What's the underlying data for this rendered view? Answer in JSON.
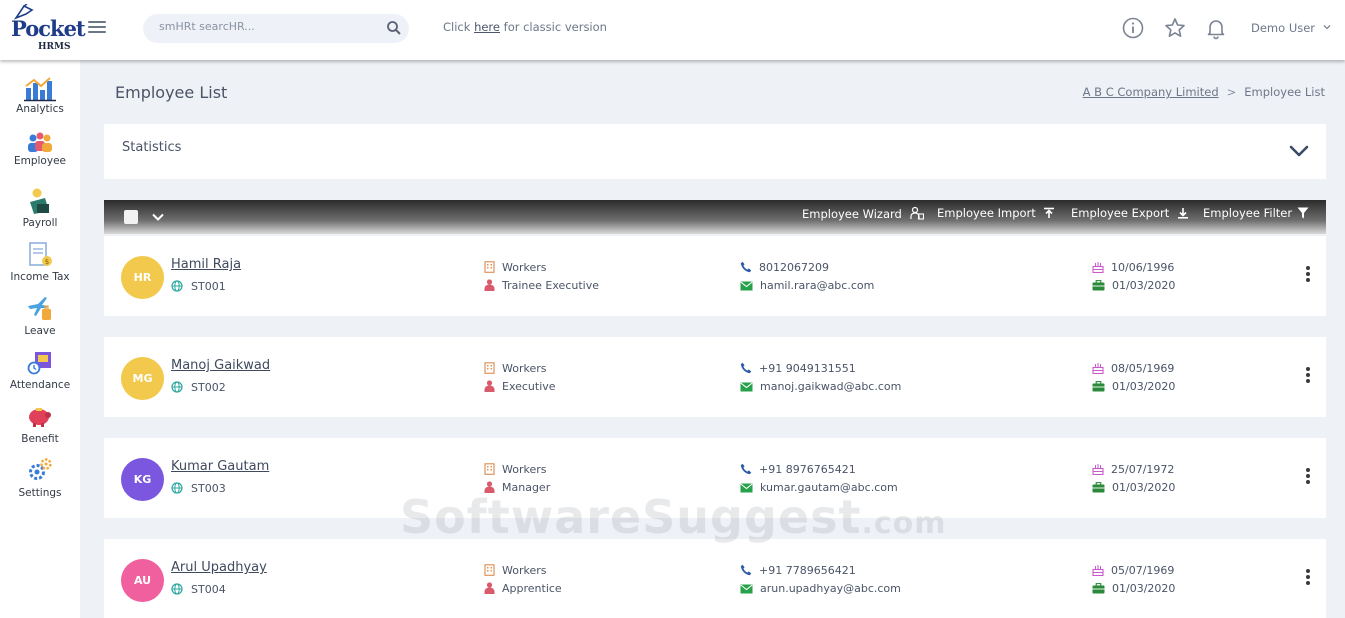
{
  "brand": {
    "logo_text": "Pocket",
    "logo_sub": "HRMS"
  },
  "header": {
    "search_placeholder": "smHRt searcHR...",
    "classic_prefix": "Click ",
    "classic_link": "here",
    "classic_suffix": " for classic version",
    "user_name": "Demo User"
  },
  "sidebar": {
    "items": [
      {
        "label": "Analytics",
        "icon": "analytics-icon"
      },
      {
        "label": "Employee",
        "icon": "employee-icon"
      },
      {
        "label": "Payroll",
        "icon": "payroll-icon"
      },
      {
        "label": "Income Tax",
        "icon": "income-tax-icon"
      },
      {
        "label": "Leave",
        "icon": "leave-icon"
      },
      {
        "label": "Attendance",
        "icon": "attendance-icon"
      },
      {
        "label": "Benefit",
        "icon": "benefit-icon"
      },
      {
        "label": "Settings",
        "icon": "settings-icon"
      }
    ]
  },
  "page": {
    "title": "Employee List",
    "breadcrumb_company": "A B C Company Limited",
    "breadcrumb_current": "Employee List",
    "statistics_label": "Statistics"
  },
  "toolbar": {
    "wizard": "Employee Wizard",
    "import": "Employee Import",
    "export": "Employee Export",
    "filter": "Employee Filter"
  },
  "employees": [
    {
      "initials": "HR",
      "avatar_color": "#f2c94c",
      "name": "Hamil Raja",
      "code": "ST001",
      "category": "Workers",
      "designation": "Trainee Executive",
      "phone": "8012067209",
      "email": "hamil.rara@abc.com",
      "dob": "10/06/1996",
      "doj": "01/03/2020"
    },
    {
      "initials": "MG",
      "avatar_color": "#f2c94c",
      "name": "Manoj Gaikwad",
      "code": "ST002",
      "category": "Workers",
      "designation": "Executive",
      "phone": "+91 9049131551",
      "email": "manoj.gaikwad@abc.com",
      "dob": "08/05/1969",
      "doj": "01/03/2020"
    },
    {
      "initials": "KG",
      "avatar_color": "#7b57e0",
      "name": "Kumar Gautam",
      "code": "ST003",
      "category": "Workers",
      "designation": "Manager",
      "phone": "+91 8976765421",
      "email": "kumar.gautam@abc.com",
      "dob": "25/07/1972",
      "doj": "01/03/2020"
    },
    {
      "initials": "AU",
      "avatar_color": "#f0609e",
      "name": "Arul Upadhyay",
      "code": "ST004",
      "category": "Workers",
      "designation": "Apprentice",
      "phone": "+91 7789656421",
      "email": "arun.upadhyay@abc.com",
      "dob": "05/07/1969",
      "doj": "01/03/2020"
    }
  ],
  "watermark": {
    "main": "SoftwareSuggest",
    "suffix": ".com"
  }
}
